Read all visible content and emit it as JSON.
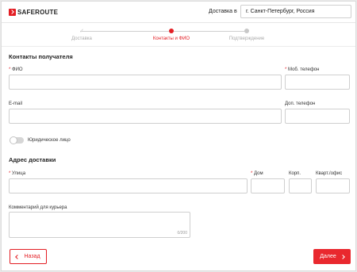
{
  "header": {
    "logo_text": "SAFEROUTE",
    "delivery_label": "Доставка в",
    "city_value": "г. Санкт-Петербург, Россия"
  },
  "stepper": {
    "steps": [
      {
        "label": "Доставка",
        "state": "done"
      },
      {
        "label": "Контакты и ФИО",
        "state": "active"
      },
      {
        "label": "Подтверждение",
        "state": "pending"
      }
    ]
  },
  "recipient": {
    "title": "Контакты получателя",
    "fio_label": "ФИО",
    "mobile_label": "Моб. телефон",
    "email_label": "E-mail",
    "extra_phone_label": "Доп. телефон",
    "legal_entity_label": "Юридическое лицо",
    "legal_entity_on": false
  },
  "address": {
    "title": "Адрес доставки",
    "street_label": "Улица",
    "house_label": "Дом",
    "building_label": "Корп.",
    "apartment_label": "Кварт./офис",
    "comment_label": "Комментарий для курьера",
    "comment_counter": "0/200"
  },
  "required_mark": "*",
  "actions": {
    "back_label": "Назад",
    "next_label": "Далее"
  },
  "colors": {
    "accent": "#e31e24",
    "border": "#cfcfcf"
  }
}
